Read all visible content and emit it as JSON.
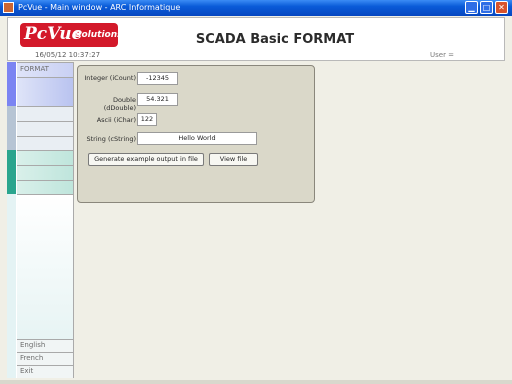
{
  "window": {
    "title": "PcVue - Main window - ARC Informatique"
  },
  "header": {
    "logo_main": "PcVue",
    "logo_sub": "Solutions",
    "datetime": "16/05/12 10:37:27",
    "title": "SCADA Basic FORMAT",
    "user": "User ="
  },
  "nav": {
    "format": "FORMAT",
    "languages": [
      "English",
      "French"
    ],
    "exit": "Exit"
  },
  "form": {
    "fields": [
      {
        "label": "Integer (iCount)",
        "value": "-12345"
      },
      {
        "label": "Double (dDouble)",
        "value": "54.321"
      },
      {
        "label": "Ascii (iChar)",
        "value": "122"
      },
      {
        "label": "String (cString)",
        "value": "Hello World"
      }
    ],
    "generate_button": "Generate example output in file",
    "view_button": "View file"
  },
  "colors": {
    "accent_blue": "#7b84f2",
    "accent_teal": "#2aa58e",
    "panel": "#dad8c9",
    "logo_red": "#d3192a"
  }
}
